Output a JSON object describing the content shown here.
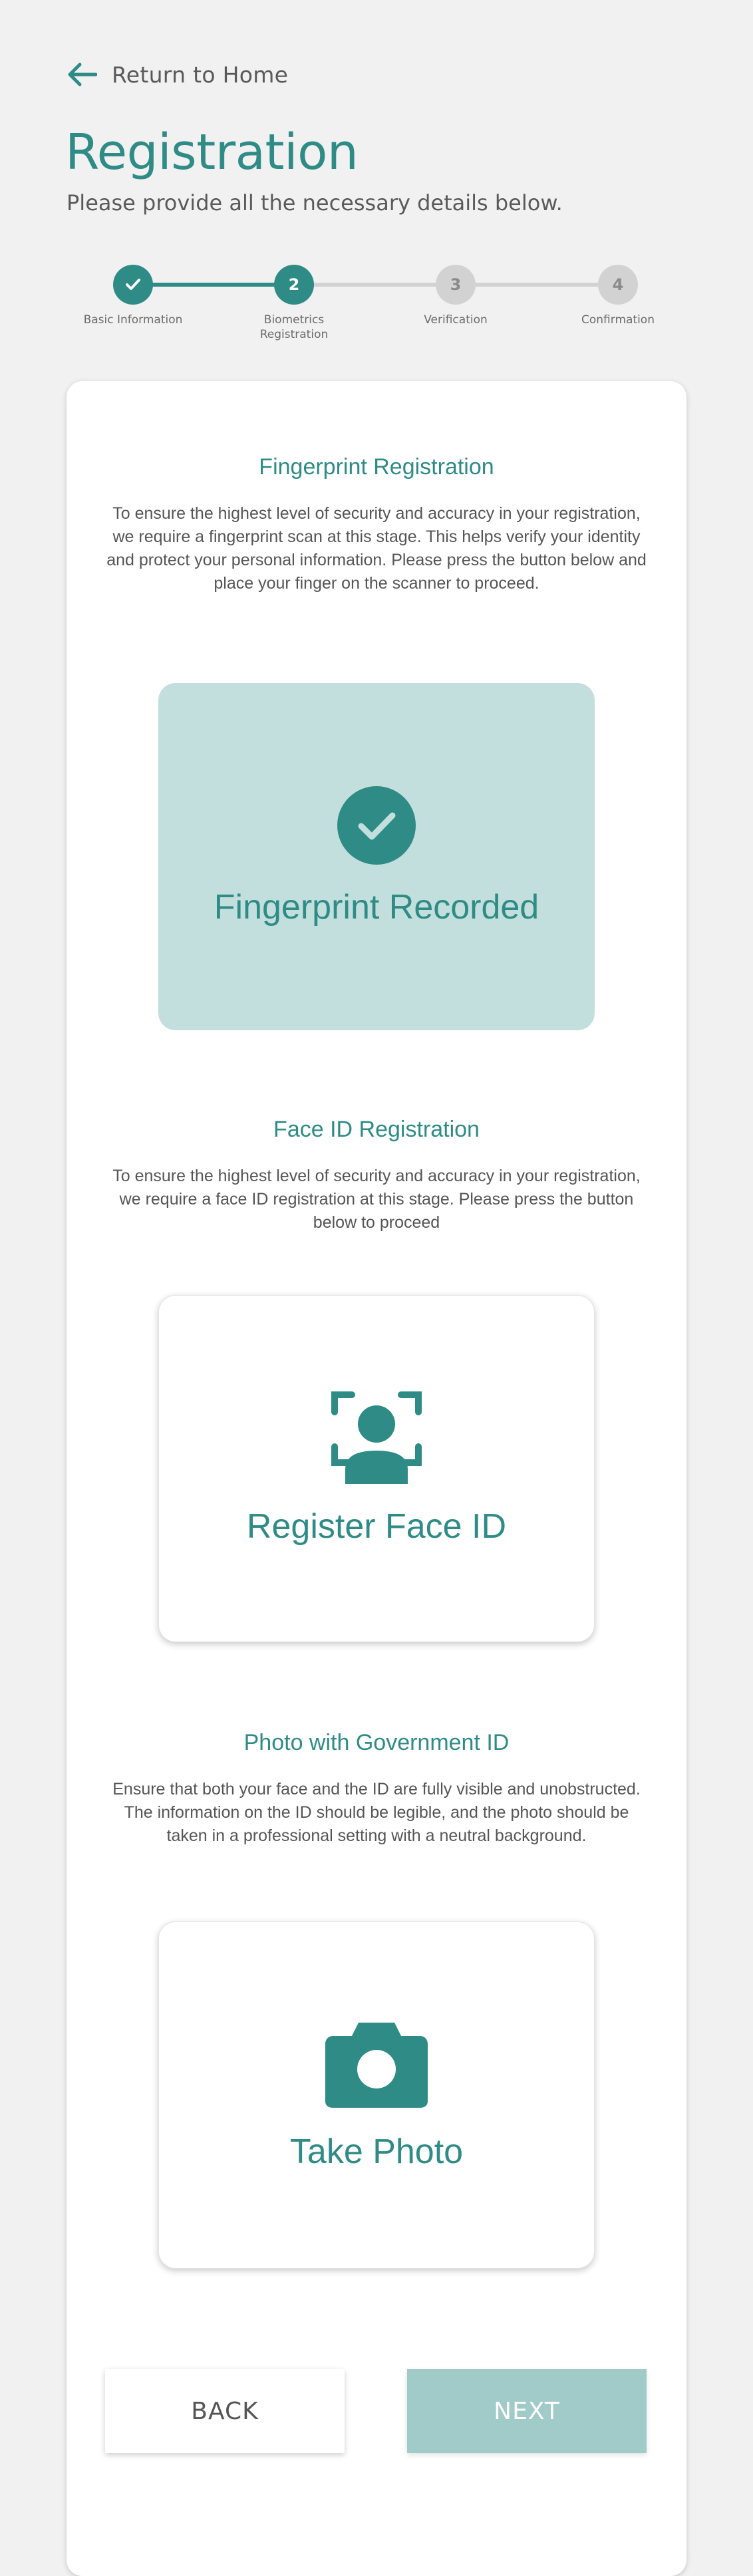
{
  "header": {
    "back_label": "Return to Home",
    "title": "Registration",
    "subtitle": "Please provide all the necessary details below."
  },
  "stepper": {
    "current_step": 2,
    "steps": [
      {
        "number": "1",
        "label": "Basic Information",
        "state": "done"
      },
      {
        "number": "2",
        "label": "Biometrics\nRegistration",
        "state": "active"
      },
      {
        "number": "3",
        "label": "Verification",
        "state": "pending"
      },
      {
        "number": "4",
        "label": "Confirmation",
        "state": "pending"
      }
    ]
  },
  "fingerprint": {
    "title": "Fingerprint Registration",
    "description": "To ensure the highest level of security and accuracy in your registration, we require a fingerprint scan at this stage. This helps verify your identity and protect your personal information. Please press the button below and place your finger on the scanner to proceed.",
    "tile_label": "Fingerprint Recorded",
    "icon": "check-circle-icon"
  },
  "face_id": {
    "title": "Face ID Registration",
    "description": "To ensure the highest level of security and accuracy in your registration, we require a face ID registration at this stage. Please press the button below to proceed",
    "tile_label": "Register Face ID",
    "icon": "face-scan-icon"
  },
  "photo_id": {
    "title": "Photo with Government ID",
    "description": "Ensure that both your face and the ID are fully visible and unobstructed. The information on the ID should be legible, and the photo should be taken in a professional setting with a neutral background.",
    "tile_label": "Take Photo",
    "icon": "camera-icon"
  },
  "actions": {
    "back_label": "BACK",
    "next_label": "NEXT"
  },
  "colors": {
    "accent": "#2e8b86",
    "tile_recorded_bg": "#c2dfdd",
    "next_disabled_bg": "#a1cbc9",
    "step_pending": "#d2d2d2",
    "page_bg": "#f1f1f1"
  }
}
